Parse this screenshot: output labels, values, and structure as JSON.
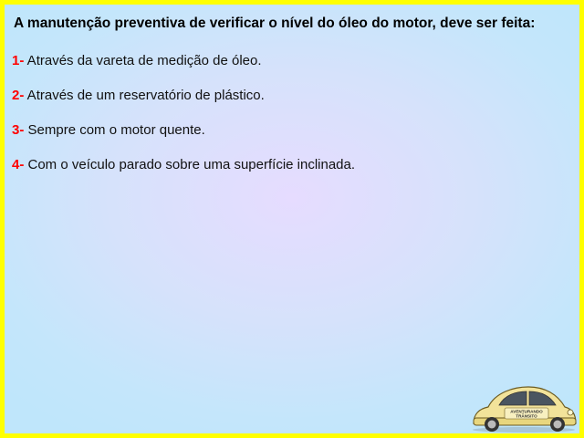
{
  "question": "A manutenção preventiva de verificar o nível do óleo do motor, deve ser feita:",
  "options": [
    {
      "number": "1-",
      "text": " Através da vareta de medição de óleo."
    },
    {
      "number": "2-",
      "text": " Através de um reservatório de plástico."
    },
    {
      "number": "3-",
      "text": " Sempre com o motor quente."
    },
    {
      "number": "4-",
      "text": " Com o veículo parado sobre uma superfície inclinada."
    }
  ],
  "logo": {
    "line1": "AVENTURANDO",
    "line2": "TRÂNSITO",
    "icon": "beetle-car-icon"
  },
  "colors": {
    "border": "#ffff00",
    "option_number": "#ff0000",
    "car_body": "#f2e39a"
  }
}
